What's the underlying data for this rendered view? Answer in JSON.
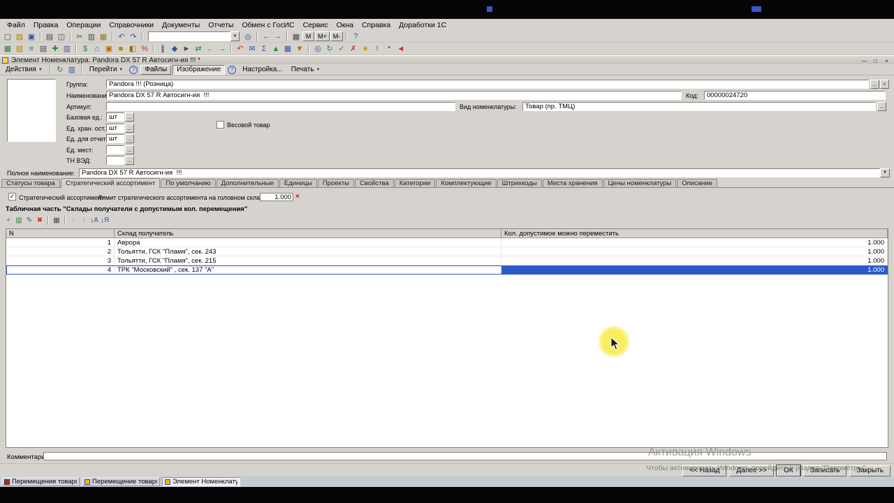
{
  "symbols": {
    "select": "...",
    "clear": "×",
    "dropdown": "▼",
    "check": "✓"
  },
  "menu": {
    "items": [
      "Файл",
      "Правка",
      "Операции",
      "Справочники",
      "Документы",
      "Отчеты",
      "Обмен с ГосИС",
      "Сервис",
      "Окна",
      "Справка",
      "Доработки 1С"
    ]
  },
  "toolbar_main": {
    "combo_value": "",
    "icons_left": [
      {
        "name": "new-document-icon",
        "glyph": "▢",
        "color": "#4a4a46"
      },
      {
        "name": "open-icon",
        "glyph": "▨",
        "color": "#b08900"
      },
      {
        "name": "save-icon",
        "glyph": "▣",
        "color": "#33549c"
      },
      {
        "name": "separator"
      },
      {
        "name": "print-icon",
        "glyph": "▤",
        "color": "#4a4a46"
      },
      {
        "name": "print-preview-icon",
        "glyph": "◫",
        "color": "#4a4a46"
      },
      {
        "name": "separator"
      },
      {
        "name": "cut-icon",
        "glyph": "✂",
        "color": "#4a4a46"
      },
      {
        "name": "copy-icon",
        "glyph": "▥",
        "color": "#4a4a46"
      },
      {
        "name": "paste-icon",
        "glyph": "▦",
        "color": "#8a7a30"
      },
      {
        "name": "separator"
      },
      {
        "name": "undo-icon",
        "glyph": "↶",
        "color": "#2f56b0"
      },
      {
        "name": "redo-icon",
        "glyph": "↷",
        "color": "#2f56b0"
      },
      {
        "name": "separator"
      }
    ],
    "icons_right": [
      {
        "name": "find-icon",
        "glyph": "◎",
        "color": "#33549c"
      },
      {
        "name": "separator"
      },
      {
        "name": "back-icon",
        "glyph": "←",
        "color": "#2e7d32"
      },
      {
        "name": "forward-icon",
        "glyph": "→",
        "color": "#2e7d32"
      },
      {
        "name": "separator"
      },
      {
        "name": "calculator-icon",
        "glyph": "▦",
        "color": "#4a4a46"
      },
      {
        "name": "memory-button",
        "label": "M"
      },
      {
        "name": "memory-plus-button",
        "label": "M+"
      },
      {
        "name": "memory-minus-button",
        "label": "M-"
      },
      {
        "name": "separator"
      },
      {
        "name": "help-icon",
        "glyph": "?",
        "color": "#33549c"
      }
    ]
  },
  "toolbar_secondary": {
    "icons": [
      {
        "name": "catalog-icon",
        "glyph": "▦",
        "color": "#2e7d32"
      },
      {
        "name": "folder-icon",
        "glyph": "▧",
        "color": "#b08900"
      },
      {
        "name": "list-icon",
        "glyph": "≡",
        "color": "#33549c"
      },
      {
        "name": "document-icon",
        "glyph": "▤",
        "color": "#4a4a46"
      },
      {
        "name": "new-item-icon",
        "glyph": "✚",
        "color": "#1e8e3e"
      },
      {
        "name": "journal-icon",
        "glyph": "▥",
        "color": "#6a3fa0"
      },
      {
        "name": "separator"
      },
      {
        "name": "money-icon",
        "glyph": "$",
        "color": "#1e8e3e"
      },
      {
        "name": "bank-icon",
        "glyph": "⌂",
        "color": "#33549c"
      },
      {
        "name": "cash-register-icon",
        "glyph": "▣",
        "color": "#c06500"
      },
      {
        "name": "goods-icon",
        "glyph": "■",
        "color": "#b08900"
      },
      {
        "name": "box-icon",
        "glyph": "◧",
        "color": "#9a6b1f"
      },
      {
        "name": "price-icon",
        "glyph": "%",
        "color": "#c23030"
      },
      {
        "name": "separator"
      },
      {
        "name": "barcode-icon",
        "glyph": "∥",
        "color": "#333333"
      },
      {
        "name": "scales-icon",
        "glyph": "◆",
        "color": "#33549c"
      },
      {
        "name": "delivery-icon",
        "glyph": "►",
        "color": "#4a4a46"
      },
      {
        "name": "transfer-icon",
        "glyph": "⇄",
        "color": "#1e8e3e"
      },
      {
        "name": "purchase-icon",
        "glyph": "←",
        "color": "#c06500"
      },
      {
        "name": "sale-icon",
        "glyph": "→",
        "color": "#2e7d32"
      },
      {
        "name": "separator"
      },
      {
        "name": "return-icon",
        "glyph": "↶",
        "color": "#c23030"
      },
      {
        "name": "invoice-icon",
        "glyph": "✉",
        "color": "#33549c"
      },
      {
        "name": "report-icon",
        "glyph": "Σ",
        "color": "#6a3fa0"
      },
      {
        "name": "chart-icon",
        "glyph": "▲",
        "color": "#1e8e3e"
      },
      {
        "name": "table-icon",
        "glyph": "▦",
        "color": "#33549c"
      },
      {
        "name": "filter-icon",
        "glyph": "▼",
        "color": "#c06500"
      },
      {
        "name": "separator"
      },
      {
        "name": "search-icon",
        "glyph": "◎",
        "color": "#33549c"
      },
      {
        "name": "refresh-icon",
        "glyph": "↻",
        "color": "#1e8e3e"
      },
      {
        "name": "approve-icon",
        "glyph": "✓",
        "color": "#1e8e3e"
      },
      {
        "name": "cancel-icon",
        "glyph": "✗",
        "color": "#c23030"
      },
      {
        "name": "star-icon",
        "glyph": "★",
        "color": "#c0a000"
      },
      {
        "name": "alert-icon",
        "glyph": "!",
        "color": "#c23030"
      },
      {
        "name": "settings-icon",
        "glyph": "*",
        "color": "#4a4a46"
      },
      {
        "name": "exit-icon",
        "glyph": "◄",
        "color": "#c23030"
      }
    ]
  },
  "document_window": {
    "title": "Элемент Номенклатура: Pandora DX 57 R Автосигн-ия  !!! *",
    "controls": [
      {
        "name": "minimize-button",
        "glyph": "—"
      },
      {
        "name": "restore-button",
        "glyph": "□"
      },
      {
        "name": "close-button",
        "glyph": "×"
      }
    ]
  },
  "action_bar": {
    "actions_label": "Действия",
    "icons": [
      {
        "name": "reread-icon",
        "glyph": "↻",
        "color": "#2e7d32"
      },
      {
        "name": "copy-icon",
        "glyph": "▥",
        "color": "#33549c"
      }
    ],
    "goto_label": "Перейти",
    "help_icon": "?",
    "files_label": "Файлы",
    "image_label": "Изображение",
    "info_icon": "?",
    "settings_label": "Настройка...",
    "print_label": "Печать"
  },
  "form": {
    "group": {
      "label": "Группа:",
      "value": "Pandora !!! (Розница)"
    },
    "name": {
      "label": "Наименование:",
      "value": "Pandora DX 57 R Автосигн-ия  !!!"
    },
    "code": {
      "label": "Код:",
      "value": "00000024720"
    },
    "article": {
      "label": "Артикул:",
      "value": ""
    },
    "kind": {
      "label": "Вид номенклатуры:",
      "value": "Товар (пр. ТМЦ)"
    },
    "base_unit": {
      "label": "Базовая ед.:",
      "value": "шт"
    },
    "weight_flag": {
      "label": "Весовой товар",
      "checked": false
    },
    "storage_unit": {
      "label": "Ед. хран. ост.:",
      "value": "шт"
    },
    "report_unit": {
      "label": "Ед. для отчетов:",
      "value": "шт"
    },
    "places_unit": {
      "label": "Ед. мест:",
      "value": ""
    },
    "tnved": {
      "label": "ТН ВЭД:",
      "value": ""
    },
    "full_name": {
      "label": "Полное наименование:",
      "value": "Pandora DX 57 R Автосигн-ия  !!!"
    }
  },
  "tabs": {
    "active_index": 1,
    "items": [
      "Статусы товара",
      "Стратегический ассортимент",
      "По умолчанию",
      "Дополнительные",
      "Единицы",
      "Проекты",
      "Свойства",
      "Категории",
      "Комплектующие",
      "Штрихкоды",
      "Места хранения",
      "Цены номенклатуры",
      "Описание"
    ]
  },
  "strategic_tab": {
    "flag_label": "Стратегический ассортимент",
    "flag_checked": true,
    "limit_label": "Лимит стратегического ассортимента на головном складе:",
    "limit_value": "1.000",
    "section_title": "Табличная часть \"Склады получатели с допустимым кол. перемещения\"",
    "toolbar_icons": [
      {
        "name": "add-row-icon",
        "glyph": "+",
        "color": "#1e8e3e"
      },
      {
        "name": "copy-row-icon",
        "glyph": "▥",
        "color": "#2e7d32"
      },
      {
        "name": "edit-row-icon",
        "glyph": "✎",
        "color": "#33549c"
      },
      {
        "name": "delete-row-icon",
        "glyph": "✖",
        "color": "#c23030"
      },
      {
        "name": "separator"
      },
      {
        "name": "end-edit-icon",
        "glyph": "▦",
        "color": "#4a4a46"
      },
      {
        "name": "separator"
      },
      {
        "name": "move-up-icon",
        "glyph": "↑",
        "color": "#9b9b95"
      },
      {
        "name": "move-down-icon",
        "glyph": "↓",
        "color": "#9b9b95"
      },
      {
        "name": "sort-asc-icon",
        "glyph": "↓А",
        "color": "#33549c"
      },
      {
        "name": "sort-desc-icon",
        "glyph": "↓Я",
        "color": "#33549c"
      }
    ],
    "table": {
      "columns": [
        "N",
        "Склад получатель",
        "Кол. допустимое можно переместить"
      ],
      "rows": [
        {
          "n": "1",
          "warehouse": "Аврора",
          "qty": "1.000",
          "selected": false
        },
        {
          "n": "2",
          "warehouse": "Тольятти, ГСК \"Пламя\", сек. 243",
          "qty": "1.000",
          "selected": false
        },
        {
          "n": "3",
          "warehouse": "Тольятти, ГСК \"Пламя\", сек. 215",
          "qty": "1.000",
          "selected": false
        },
        {
          "n": "4",
          "warehouse": "ТРК \"Московский\" , сек. 137 \"А\"",
          "qty": "1.000",
          "selected": true
        }
      ]
    }
  },
  "comment": {
    "label": "Комментарий:",
    "value": ""
  },
  "footer_buttons": [
    {
      "name": "back-button",
      "label": "<< Назад",
      "default": false
    },
    {
      "name": "next-button",
      "label": "Далее >>",
      "default": false
    },
    {
      "name": "ok-button",
      "label": "ОК",
      "default": true
    },
    {
      "name": "write-button",
      "label": "Записать",
      "default": false
    },
    {
      "name": "close-button",
      "label": "Закрыть",
      "default": false
    }
  ],
  "watermark": {
    "line1": "Активация Windows",
    "line2": "Чтобы активировать Windows, перейдите в раздел \"Параметры\"."
  },
  "taskbar": {
    "items": [
      {
        "label": "Перемещения товаров",
        "active": false
      },
      {
        "label": "Перемещение товаров: тов...",
        "active": false
      },
      {
        "label": "Элемент Номенклатура: Ра...",
        "active": true
      }
    ]
  }
}
